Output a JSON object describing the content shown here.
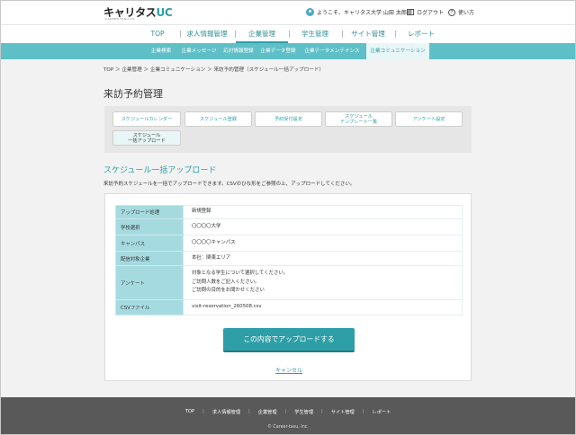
{
  "header": {
    "logo_main": "キャリタス",
    "logo_uc": "UC",
    "logo_sub": "CAREER-TASU UC",
    "greeting": "ようこそ、キャリタス大学 山田 太郎様",
    "logout": "ログアウト",
    "help": "使い方"
  },
  "main_nav": [
    "TOP",
    "求人情報管理",
    "企業管理",
    "学生管理",
    "サイト管理",
    "レポート"
  ],
  "sub_nav": [
    "企業検索",
    "企業メッセージ",
    "応対情報登録",
    "企業データ登録",
    "企業データメンテナンス",
    "企業コミュニケーション"
  ],
  "breadcrumb": "TOP ＞ 企業管理 ＞ 企業コミュニケーション ＞ 来訪予約管理（スケジュール一括アップロード）",
  "page_title": "来訪予約管理",
  "tabs": [
    "スケジュールカレンダー",
    "スケジュール登録",
    "予約受付設定",
    "スケジュール\nテンプレート一覧",
    "アンケート設定",
    "スケジュール\n一括アップロード"
  ],
  "section_title": "スケジュール一括アップロード",
  "description": "来訪予約スケジュールを一括でアップロードできます。CSVのひな形をご参照の上、アップロードしてください。",
  "table": {
    "rows": [
      {
        "label": "アップロード処理",
        "value": "新規登録"
      },
      {
        "label": "学校選択",
        "value": "〇〇〇〇大学"
      },
      {
        "label": "キャンパス",
        "value": "〇〇〇〇キャンパス"
      },
      {
        "label": "配信対象企業",
        "value": "本社：関東エリア"
      },
      {
        "label": "アンケート",
        "value": "対象となる学生について選択してください。\nご訪問人数をご記入ください。\nご訪問の目的をお聞かせください"
      },
      {
        "label": "CSVファイル",
        "value": "visit-reservation_260508.csv"
      }
    ]
  },
  "buttons": {
    "upload": "この内容でアップロードする",
    "cancel": "キャンセル"
  },
  "footer": {
    "links": [
      "TOP",
      "求人情報管理",
      "企業管理",
      "学生管理",
      "サイト管理",
      "レポート"
    ],
    "copyright": "© Career-tasu, Inc."
  },
  "colors": {
    "accent": "#2e9fa6",
    "subnav": "#5fbfc6",
    "table_header": "#a5dbe0",
    "footer": "#595959"
  }
}
